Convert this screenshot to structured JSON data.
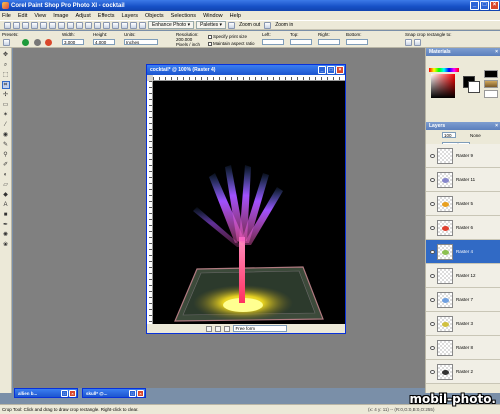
{
  "app": {
    "title": "Corel Paint Shop Pro Photo XI - cocktail",
    "window_controls": [
      "_",
      "□",
      "×"
    ]
  },
  "menu": [
    "File",
    "Edit",
    "View",
    "Image",
    "Adjust",
    "Effects",
    "Layers",
    "Objects",
    "Selections",
    "Window",
    "Help"
  ],
  "toolbar": {
    "enhance_photo": "Enhance Photo ▾",
    "palettes": "Palettes ▾",
    "zoom_out": "Zoom out",
    "zoom_in": "Zoom in"
  },
  "tool_options": {
    "presets_label": "Presets:",
    "width_label": "Width:",
    "width_value": "3.000",
    "height_label": "Height:",
    "height_value": "4.000",
    "units_label": "Units:",
    "units_value": "Inches",
    "resolution_label": "Resolution:",
    "resolution_value": "200.000",
    "resolution_unit": "Pixels / inch",
    "specify_print_size": "Specify print size",
    "maintain_aspect_ratio": "Maintain aspect ratio",
    "left_label": "Left:",
    "top_label": "Top:",
    "right_label": "Right:",
    "bottom_label": "Bottom:",
    "snap_label": "Snap crop rectangle to:"
  },
  "document": {
    "title": "cocktail* @ 100% (Raster 4)",
    "selection_mode": "Free form"
  },
  "panels": {
    "materials_title": "Materials",
    "layers_title": "Layers",
    "opacity_value": "100",
    "blend_mode": "Normal",
    "lock_label": "None"
  },
  "layers": [
    {
      "name": "Raster 9",
      "selected": false,
      "mark_color": ""
    },
    {
      "name": "Raster 11",
      "selected": false,
      "mark_color": "#88c"
    },
    {
      "name": "Raster 5",
      "selected": false,
      "mark_color": "#e8a020"
    },
    {
      "name": "Raster 6",
      "selected": false,
      "mark_color": "#e04030"
    },
    {
      "name": "Raster 4",
      "selected": true,
      "mark_color": "#8cc050"
    },
    {
      "name": "Raster 12",
      "selected": false,
      "mark_color": ""
    },
    {
      "name": "Raster 7",
      "selected": false,
      "mark_color": "#70a0e0"
    },
    {
      "name": "Raster 3",
      "selected": false,
      "mark_color": "#d0c040"
    },
    {
      "name": "Raster 8",
      "selected": false,
      "mark_color": ""
    },
    {
      "name": "Raster 2",
      "selected": false,
      "mark_color": "#333"
    }
  ],
  "minimized_windows": [
    {
      "title": "allien b..."
    },
    {
      "title": "skull* @..."
    }
  ],
  "statusbar": {
    "hint": "Crop Tool: Click and drag to draw crop rectangle. Right-click to clear.",
    "info": "(x: 4 y: 11) -- (R:0,G:0,B:0,O:255)"
  },
  "watermark": "mobil-photo."
}
